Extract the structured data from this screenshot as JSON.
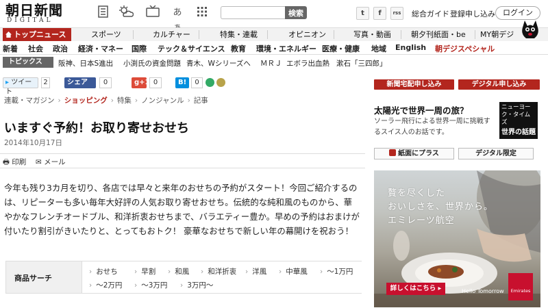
{
  "header": {
    "logo_main": "朝日新聞",
    "logo_sub": "DIGITAL",
    "icons": [
      "newspaper-icon",
      "weather-icon",
      "tv-icon",
      "font-size-icon",
      "grid-icon"
    ],
    "font_icon_text": "あぁ",
    "search_button": "検索",
    "social": {
      "twitter": "t",
      "facebook": "f",
      "rss": "rss"
    },
    "links": [
      "総合ガイド",
      "登録申し込み"
    ],
    "login": "ログイン"
  },
  "nav1": [
    "トップニュース",
    "スポーツ",
    "カルチャー",
    "特集・連載",
    "オピニオン",
    "写真・動画",
    "朝夕刊紙面・be",
    "MY朝デジ"
  ],
  "nav2": [
    "新着",
    "社会",
    "政治",
    "経済・マネー",
    "国際",
    "テック＆サイエンス",
    "教育",
    "環境・エネルギー",
    "医療・健康",
    "地域",
    "English",
    "朝デジスペシャル"
  ],
  "topics": {
    "label": "トピックス",
    "items": [
      "阪神、日本S進出",
      "小渕氏の資金問題",
      "青木、Wシリーズへ",
      "ＭＲＪ",
      "エボラ出血熱",
      "漱石「三四郎」"
    ]
  },
  "share": {
    "tweet": "ツイート",
    "tweet_count": "2",
    "fb": "シェア",
    "fb_count": "0",
    "gplus": "g+1",
    "gplus_count": "0",
    "hatena": "B!",
    "hatena_count": "0"
  },
  "breadcrumb": [
    "連載・マガジン",
    "ショッピング",
    "特集",
    "ノンジャンル",
    "記事"
  ],
  "article": {
    "title": "いますぐ予約！お取り寄せおせち",
    "date": "2014年10月17日",
    "print": "印刷",
    "mail": "メール",
    "body": "今年も残り3カ月を切り、各店では早々と来年のおせちの予約がスタート！今回ご紹介するのは、リピーターも多い毎年大好評の人気お取り寄せおせち。伝統的な純和風のものから、華やかなフレンチオードブル、和洋折衷おせちまで、バラエティー豊か。早めの予約はおまけが付いたり割引がきいたりと、とってもおトク！ 豪華なおせちで新しい年の幕開けを祝おう！"
  },
  "product_search": {
    "label": "商品サーチ",
    "keywords": [
      "おせち",
      "早割",
      "和風",
      "和洋折衷",
      "洋風",
      "中華風",
      "〜1万円",
      "〜2万円",
      "〜3万円",
      "3万円〜"
    ]
  },
  "right": {
    "btn1": "新聞宅配申し込み",
    "btn2": "デジタル申し込み",
    "ny_title": "太陽光で世界一周の旅？",
    "ny_desc": "ソーラー飛行による世界一周に挑戦するスイス人のお話です。",
    "ny_logo_small": "ニューヨーク・タイムズ",
    "ny_logo_big": "世界の話題",
    "paper_plus": "紙面にプラス",
    "digital_limited": "デジタル限定",
    "ad": {
      "line1": "贅を尽くした",
      "line2": "おいしさを、世界から。",
      "line3": "エミレーツ航空",
      "cta": "詳しくはこちら ▸",
      "tagline": "Hello Tomorrow",
      "brand": "Emirates"
    }
  },
  "colors": {
    "accent": "#b3261e",
    "ad_red": "#c8102e"
  }
}
